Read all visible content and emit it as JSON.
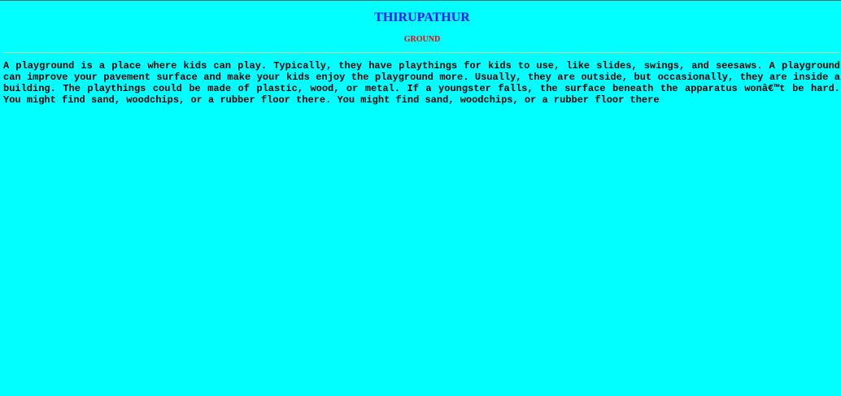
{
  "page": {
    "title": "THIRUPATHUR",
    "subtitle": "GROUND",
    "paragraph": "A playground is a place where kids can play. Typically, they have playthings for kids to use, like slides, swings, and seesaws. A playground can improve your pavement surface and make your kids enjoy the playground more. Usually, they are outside, but occasionally, they are inside a building. The playthings could be made of plastic, wood, or metal. If a youngster falls, the surface beneath the apparatus wonâ€™t be hard. You might find sand, woodchips, or a rubber floor there. You might find sand, woodchips, or a rubber floor there"
  },
  "colors": {
    "background": "#00ffff",
    "title": "#1414ff",
    "subtitle": "#ff0000",
    "text": "#000000",
    "divider": "#c8d0a0"
  }
}
